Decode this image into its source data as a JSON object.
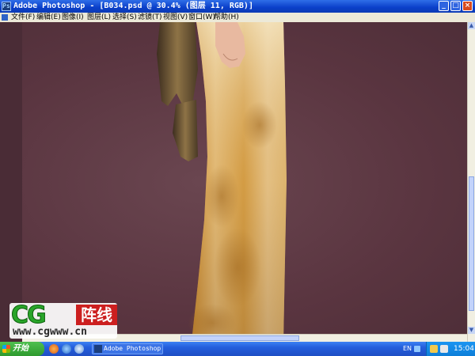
{
  "window": {
    "title": "Adobe Photoshop - [B034.psd @ 30.4% (图层 11, RGB)]",
    "app_icon": "photoshop-icon",
    "buttons": {
      "minimize": "_",
      "maximize": "□",
      "close": "×"
    }
  },
  "menu": {
    "items": [
      {
        "label": "文件(F)"
      },
      {
        "label": "编辑(E)"
      },
      {
        "label": "图像(I)"
      },
      {
        "label": "图层(L)"
      },
      {
        "label": "选择(S)"
      },
      {
        "label": "滤镜(T)"
      },
      {
        "label": "视图(V)"
      },
      {
        "label": "窗口(W)"
      },
      {
        "label": "帮助(H)"
      }
    ]
  },
  "watermark": {
    "logo_text": "CG",
    "logo_cn": "阵线",
    "url": "www.cgwww.cn"
  },
  "taskbar": {
    "start_label": "开始",
    "task_label": "Adobe Photoshop ...",
    "lang": "EN",
    "clock": "15:04"
  },
  "colors": {
    "canvas_bg": "#5e3a44",
    "titlebar": "#0a3fc9",
    "taskbar": "#245edc",
    "start": "#2e9a2e"
  }
}
